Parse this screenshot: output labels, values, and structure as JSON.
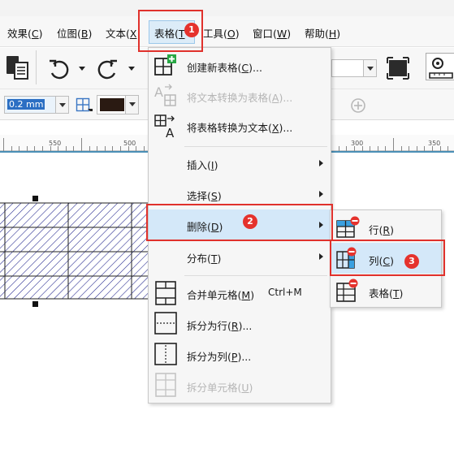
{
  "menubar": {
    "items": [
      {
        "text": "效果(",
        "key": "C",
        "end": ")"
      },
      {
        "text": "位图(",
        "key": "B",
        "end": ")"
      },
      {
        "text": "文本(",
        "key": "X",
        "end": ""
      },
      {
        "text": "表格(",
        "key": "T",
        "end": ""
      },
      {
        "text": "工具(",
        "key": "O",
        "end": ")"
      },
      {
        "text": "窗口(",
        "key": "W",
        "end": ")"
      },
      {
        "text": "帮助(",
        "key": "H",
        "end": ")"
      }
    ]
  },
  "toolbar": {
    "line_width": "0.2 mm"
  },
  "ruler": {
    "labels": [
      "550",
      "500",
      "300",
      "350"
    ]
  },
  "table_menu": {
    "items": [
      {
        "text": "创建新表格(",
        "key": "C",
        "end": ")...",
        "icon": "create-table-icon"
      },
      {
        "text": "将文本转换为表格(",
        "key": "A",
        "end": ")...",
        "icon": "text-to-table-icon",
        "disabled": true
      },
      {
        "text": "将表格转换为文本(",
        "key": "X",
        "end": ")...",
        "icon": "table-to-text-icon"
      },
      {
        "text": "插入(",
        "key": "I",
        "end": ")",
        "submenu": true
      },
      {
        "text": "选择(",
        "key": "S",
        "end": ")",
        "submenu": true
      },
      {
        "text": "删除(",
        "key": "D",
        "end": ")",
        "submenu": true,
        "highlighted": true
      },
      {
        "text": "分布(",
        "key": "T",
        "end": ")",
        "submenu": true
      },
      {
        "text": "合并单元格(",
        "key": "M",
        "end": ")",
        "shortcut": "Ctrl+M",
        "icon": "merge-cells-icon"
      },
      {
        "text": "拆分为行(",
        "key": "R",
        "end": ")...",
        "icon": "split-rows-icon"
      },
      {
        "text": "拆分为列(",
        "key": "P",
        "end": ")...",
        "icon": "split-columns-icon"
      },
      {
        "text": "拆分单元格(",
        "key": "U",
        "end": ")",
        "icon": "split-cells-icon",
        "disabled": true
      }
    ]
  },
  "delete_submenu": {
    "items": [
      {
        "text": "行(",
        "key": "R",
        "end": ")",
        "icon": "delete-row-icon"
      },
      {
        "text": "列(",
        "key": "C",
        "end": ")",
        "icon": "delete-column-icon",
        "highlighted": true
      },
      {
        "text": "表格(",
        "key": "T",
        "end": ")",
        "icon": "delete-table-icon"
      }
    ]
  },
  "annotations": {
    "badges": [
      "1",
      "2",
      "3"
    ],
    "color": "#e0312c"
  },
  "colors": {
    "highlight": "#d4e8f9",
    "menu_active": "#dcecf8",
    "hatch": "#1b1f8a",
    "ruler_accent": "#4a8fb6"
  }
}
